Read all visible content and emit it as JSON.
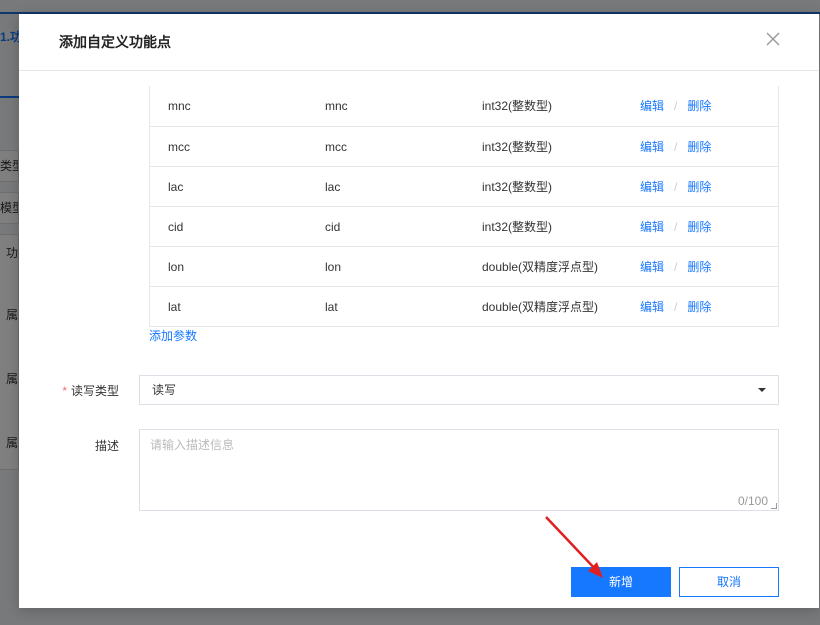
{
  "background": {
    "breadcrumb": "1.功",
    "side_labels": [
      "类型",
      "模型",
      "功类",
      "属",
      "属",
      "属"
    ]
  },
  "modal": {
    "title": "添加自定义功能点",
    "params": [
      {
        "name": "mnc",
        "id": "mnc",
        "type": "int32(整数型)"
      },
      {
        "name": "mcc",
        "id": "mcc",
        "type": "int32(整数型)"
      },
      {
        "name": "lac",
        "id": "lac",
        "type": "int32(整数型)"
      },
      {
        "name": "cid",
        "id": "cid",
        "type": "int32(整数型)"
      },
      {
        "name": "lon",
        "id": "lon",
        "type": "double(双精度浮点型)"
      },
      {
        "name": "lat",
        "id": "lat",
        "type": "double(双精度浮点型)"
      }
    ],
    "edit_label": "编辑",
    "separator": "/",
    "delete_label": "删除",
    "add_param_label": "添加参数",
    "rw_label": "读写类型",
    "rw_required_mark": "*",
    "rw_value": "读写",
    "desc_label": "描述",
    "desc_placeholder": "请输入描述信息",
    "desc_counter": "0/100",
    "confirm_label": "新增",
    "cancel_label": "取消"
  },
  "colors": {
    "primary": "#1677ff",
    "required": "#f56c6c",
    "annotation_arrow": "#e02020"
  }
}
